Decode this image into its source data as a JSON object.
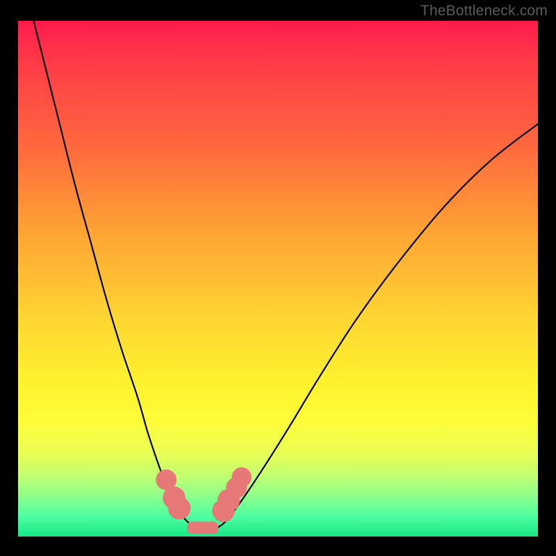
{
  "watermark": "TheBottleneck.com",
  "colors": {
    "gradient_top": "#ff1a4d",
    "gradient_mid1": "#ffa733",
    "gradient_mid2": "#fff22e",
    "gradient_bottom": "#17e98a",
    "curve": "#000000",
    "marker": "#e77878",
    "frame": "#000000"
  },
  "chart_data": {
    "type": "line",
    "title": "",
    "xlabel": "",
    "ylabel": "",
    "xlim": [
      0,
      100
    ],
    "ylim": [
      0,
      100
    ],
    "grid": false,
    "legend": false,
    "series": [
      {
        "name": "left-curve",
        "x": [
          3,
          5,
          8,
          11,
          14,
          17,
          20,
          23,
          25,
          27,
          28.5,
          30,
          31,
          32,
          33,
          34
        ],
        "y": [
          100,
          92,
          80,
          68,
          57,
          46,
          36,
          27,
          20,
          14,
          10,
          7,
          5,
          3.5,
          2.5,
          1.5
        ]
      },
      {
        "name": "right-curve",
        "x": [
          38,
          40,
          43,
          47,
          52,
          58,
          65,
          73,
          82,
          91,
          100
        ],
        "y": [
          1.5,
          3,
          7,
          13,
          21,
          31,
          42,
          53,
          64,
          73,
          80
        ]
      },
      {
        "name": "valley-floor",
        "x": [
          34,
          35,
          36,
          37,
          38
        ],
        "y": [
          1.5,
          1.2,
          1.1,
          1.2,
          1.5
        ]
      }
    ],
    "markers": [
      {
        "x": 28.5,
        "y": 11,
        "r": 1.4
      },
      {
        "x": 30,
        "y": 7.5,
        "r": 1.6
      },
      {
        "x": 31,
        "y": 5.5,
        "r": 1.6
      },
      {
        "x": 39.5,
        "y": 5,
        "r": 1.6
      },
      {
        "x": 40.5,
        "y": 7,
        "r": 1.6
      },
      {
        "x": 42,
        "y": 9.5,
        "r": 1.4
      },
      {
        "x": 43,
        "y": 11.5,
        "r": 1.3
      }
    ],
    "floor_pill": {
      "x0": 32.5,
      "x1": 38.5,
      "y": 1.7,
      "h": 2.4
    }
  }
}
